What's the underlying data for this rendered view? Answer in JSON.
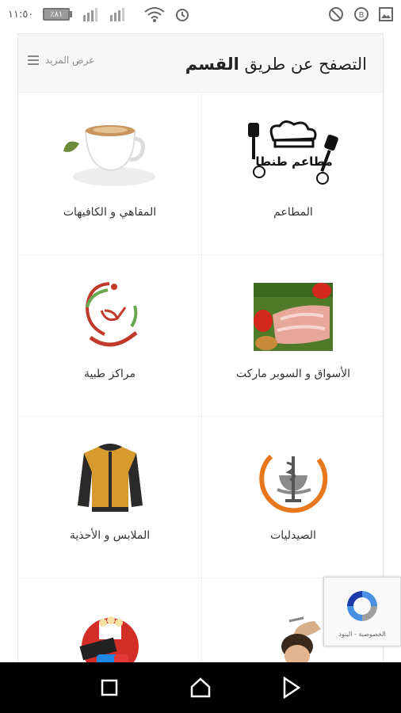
{
  "status_bar": {
    "time": "١١:٥٠",
    "battery_level": "٪٨١"
  },
  "header": {
    "title_part1": "التصفح عن طريق",
    "title_part2": "القسم",
    "view_more": "عرض المزيد"
  },
  "categories": [
    {
      "label": "المطاعم",
      "icon": "restaurants-logo"
    },
    {
      "label": "المقاهي و الكافيهات",
      "icon": "coffee-cup"
    },
    {
      "label": "الأسواق و السوبر ماركت",
      "icon": "meat-vegetables"
    },
    {
      "label": "مراكز طبية",
      "icon": "stethoscope-hand"
    },
    {
      "label": "الصيدليات",
      "icon": "pharmacy-symbol"
    },
    {
      "label": "الملابس و الأحذية",
      "icon": "jacket"
    },
    {
      "label": "",
      "icon": "barber-haircut"
    },
    {
      "label": "",
      "icon": "cinema-popcorn"
    }
  ],
  "restaurant_logo_text": "مطاعم طنطا",
  "recaptcha": {
    "links": "الخصوصية - البنود"
  },
  "colors": {
    "accent_orange": "#e8781e",
    "accent_red": "#c0392b"
  }
}
